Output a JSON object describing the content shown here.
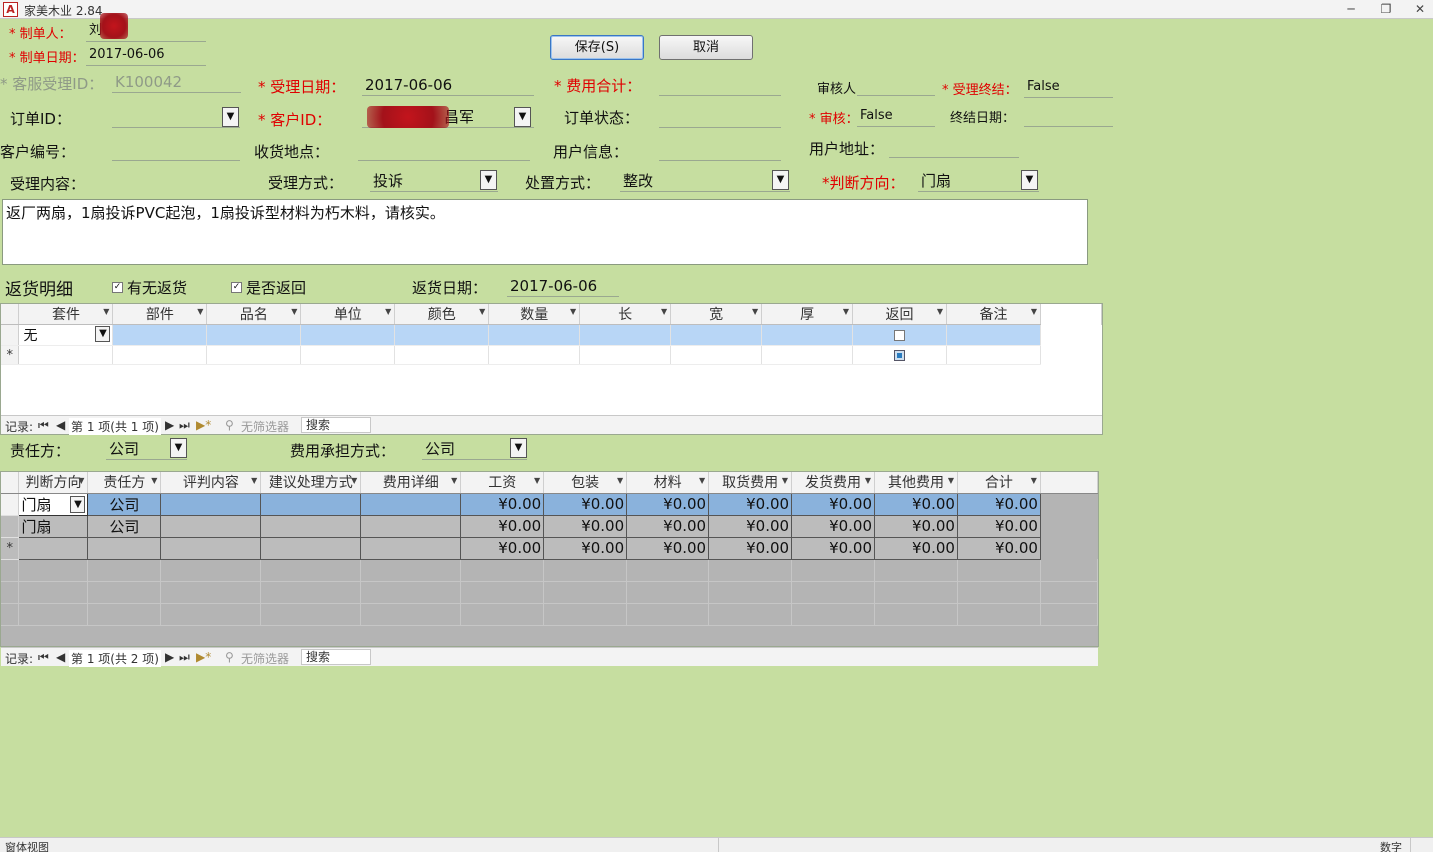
{
  "window": {
    "app_icon": "A",
    "title": "家美木业 2.84",
    "min": "─",
    "restore": "❐",
    "close": "✕"
  },
  "form": {
    "creator_label": "* 制单人：",
    "creator_value": "刘",
    "create_date_label": "* 制单日期：",
    "create_date_value": "2017-06-06",
    "service_id_label": "* 客服受理ID：",
    "service_id_value": "K100042",
    "accept_date_label": "* 受理日期：",
    "accept_date_value": "2017-06-06",
    "cost_total_label": "* 费用合计：",
    "cost_total_value": "",
    "reviewer_label": "审核人",
    "reviewer_value": "",
    "accept_end_label": "* 受理终结：",
    "accept_end_value": "False",
    "order_id_label": "订单ID：",
    "order_id_value": "",
    "customer_id_label": "* 客户ID：",
    "customer_id_value": "昌军",
    "order_status_label": "订单状态：",
    "order_status_value": "",
    "review_label": "* 审核：",
    "review_value": "False",
    "end_date_label": "终结日期：",
    "end_date_value": "",
    "customer_no_label": "客户编号：",
    "customer_no_value": "",
    "delivery_label": "收货地点：",
    "delivery_value": "",
    "user_info_label": "用户信息：",
    "user_info_value": "",
    "user_addr_label": "用户地址：",
    "user_addr_value": "",
    "content_label": "受理内容：",
    "method_label": "受理方式：",
    "method_value": "投诉",
    "handling_label": "处置方式：",
    "handling_value": "整改",
    "judge_dir_label": "*判断方向：",
    "judge_dir_value": "门扇",
    "memo_text": "返厂两扇，1扇投诉PVC起泡，1扇投诉型材料为朽木料，请核实。"
  },
  "buttons": {
    "save": "保存(S)",
    "cancel": "取消"
  },
  "returns": {
    "section_title": "返货明细",
    "has_return_label": "有无返货",
    "has_return_checked": true,
    "is_return_label": "是否返回",
    "is_return_checked": true,
    "return_date_label": "返货日期：",
    "return_date_value": "2017-06-06",
    "columns": [
      "套件",
      "部件",
      "品名",
      "单位",
      "颜色",
      "数量",
      "长",
      "宽",
      "厚",
      "返回",
      "备注"
    ],
    "row1_kit": "无",
    "new_row_marker": "*"
  },
  "nav1": {
    "record": "记录:",
    "first": "⏮",
    "prev": "◀",
    "position": "第 1 项(共 1 项)",
    "next": "▶",
    "last": "⏭",
    "newrec": "▶*",
    "filter": "无筛选器",
    "search": "搜索"
  },
  "responsibility": {
    "party_label": "责任方：",
    "party_value": "公司",
    "bearing_label": "费用承担方式：",
    "bearing_value": "公司"
  },
  "costs": {
    "columns": [
      "判断方向",
      "责任方",
      "评判内容",
      "建议处理方式",
      "费用详细",
      "工资",
      "包装",
      "材料",
      "取货费用",
      "发货费用",
      "其他费用",
      "合计"
    ],
    "rows": [
      {
        "dir": "门扇",
        "party": "公司",
        "wage": "¥0.00",
        "pack": "¥0.00",
        "material": "¥0.00",
        "pickup": "¥0.00",
        "ship": "¥0.00",
        "other": "¥0.00",
        "total": "¥0.00"
      },
      {
        "dir": "门扇",
        "party": "公司",
        "wage": "¥0.00",
        "pack": "¥0.00",
        "material": "¥0.00",
        "pickup": "¥0.00",
        "ship": "¥0.00",
        "other": "¥0.00",
        "total": "¥0.00"
      }
    ],
    "new_row": {
      "marker": "*",
      "wage": "¥0.00",
      "pack": "¥0.00",
      "material": "¥0.00",
      "pickup": "¥0.00",
      "ship": "¥0.00",
      "other": "¥0.00",
      "total": "¥0.00"
    }
  },
  "nav2": {
    "record": "记录:",
    "first": "⏮",
    "prev": "◀",
    "position": "第 1 项(共 2 项)",
    "next": "▶",
    "last": "⏭",
    "newrec": "▶*",
    "filter": "无筛选器",
    "search": "搜索"
  },
  "status": {
    "left": "窗体视图",
    "right": "数字"
  },
  "colors": {
    "background": "#c6dea0",
    "required": "#e00000",
    "selected_row": "#8ab2dc"
  }
}
